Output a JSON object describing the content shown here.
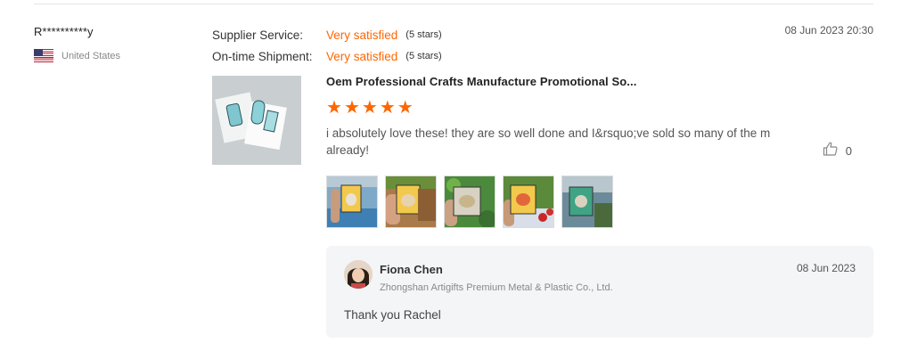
{
  "review": {
    "buyer_name": "R**********y",
    "country": "United States",
    "country_flag_icon": "us-flag-icon",
    "date": "08 Jun 2023 20:30",
    "ratings": [
      {
        "label": "Supplier Service:",
        "value": "Very satisfied",
        "stars": "(5 stars)"
      },
      {
        "label": "On-time Shipment:",
        "value": "Very satisfied",
        "stars": "(5 stars)"
      }
    ],
    "product_title": "Oem Professional Crafts Manufacture Promotional So...",
    "star_rating": 5,
    "star_glyph": "★",
    "text": "i absolutely love these! they are so well done and I&rsquo;ve sold so many of the m already!",
    "like_count": "0",
    "photo_count": 5
  },
  "reply": {
    "name": "Fiona Chen",
    "company": "Zhongshan Artigifts Premium Metal & Plastic Co., Ltd.",
    "date": "08 Jun 2023",
    "text": "Thank you Rachel"
  },
  "colors": {
    "accent": "#ff6600",
    "reply_bg": "#f4f5f7",
    "divider": "#e5e5e5"
  }
}
